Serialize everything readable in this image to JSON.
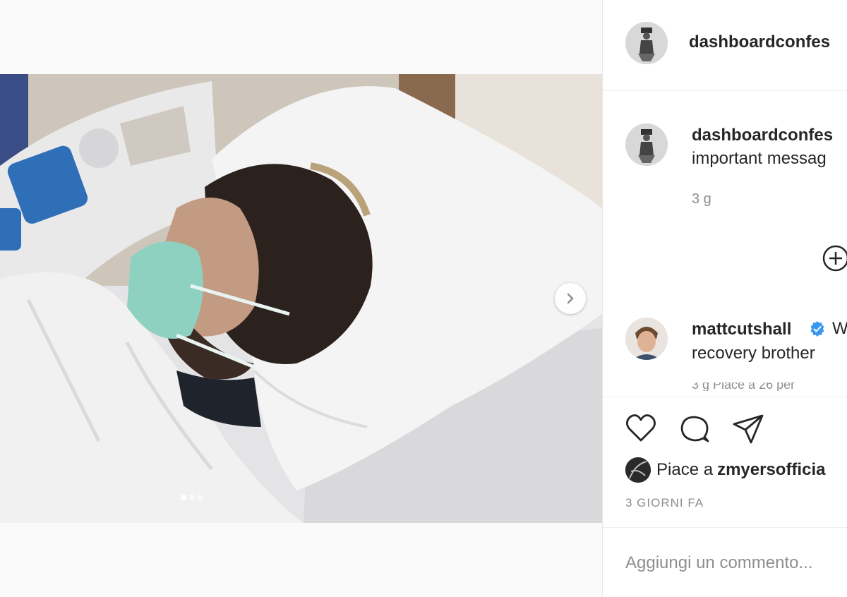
{
  "post": {
    "image_alt": "Hospital bed photo",
    "carousel": {
      "current_slide": 1,
      "total_slides": 3
    }
  },
  "header": {
    "username": "dashboardconfes"
  },
  "caption": {
    "username": "dashboardconfes",
    "text": "important messag",
    "time": "3 g"
  },
  "comment": {
    "username": "mattcutshall",
    "lead": "W",
    "text": "recovery brother",
    "meta": "3 g    Piace a 26 per"
  },
  "likes": {
    "prefix": "Piace a",
    "user": "zmyersofficia"
  },
  "date": "3 GIORNI FA",
  "add_comment": {
    "placeholder": "Aggiungi un commento..."
  },
  "icons": {
    "next": "chevron-right-icon",
    "load_more": "plus-circle-icon",
    "verified": "verified-badge-icon",
    "like": "heart-icon",
    "comment": "comment-icon",
    "share": "paper-plane-icon"
  },
  "colors": {
    "verified": "#3897f0",
    "muted": "#8e8e8e",
    "text": "#262626"
  }
}
